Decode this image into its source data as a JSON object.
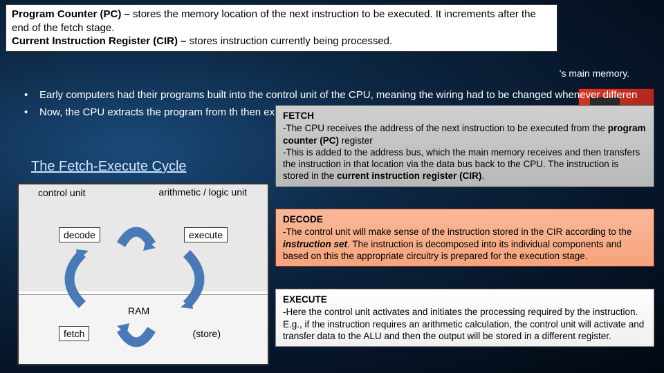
{
  "definitions": {
    "pc_label": "Program Counter (PC) – ",
    "pc_text": "stores the memory location of the next instruction to be executed. It increments after the end of the fetch stage.",
    "cir_label": "Current Instruction Register (CIR) – ",
    "cir_text": "stores instruction currently being processed."
  },
  "bg_tail": "'s main memory.",
  "bullets": {
    "b1": "Early computers had their programs built into the control unit of the CPU, meaning the wiring had to be changed whenever differen",
    "b2": "Now, the CPU extracts the program from th then executes them. Instead of rewiring, the"
  },
  "fec_title": "The Fetch-Execute Cycle",
  "diagram": {
    "control_unit": "control unit",
    "alu": "arithmetic / logic unit",
    "decode": "decode",
    "execute": "execute",
    "fetch": "fetch",
    "store": "(store)",
    "ram": "RAM"
  },
  "stages": {
    "fetch": {
      "title": "FETCH",
      "l1a": "-The CPU receives the address of the next instruction to be executed from the ",
      "l1b": "program counter (PC)",
      "l1c": " register",
      "l2a": "-This is added to the address bus, which the main memory receives and then transfers the instruction in that location via the data bus back to the CPU. The instruction is stored in the ",
      "l2b": "current instruction register (CIR)",
      "l2c": "."
    },
    "decode": {
      "title": "DECODE",
      "l1a": "-The control unit will make sense of the instruction stored in the CIR according to the ",
      "l1b": "instruction set",
      "l1c": ". The instruction is decomposed into its individual components and based on this the appropriate circuitry is prepared for the execution stage."
    },
    "execute": {
      "title": "EXECUTE",
      "l1": "-Here the control unit activates and initiates the processing required by the instruction. E.g., if the instruction requires an arithmetic calculation, the control unit will activate and transfer data to the ALU and then the output will be stored in a different register."
    }
  }
}
